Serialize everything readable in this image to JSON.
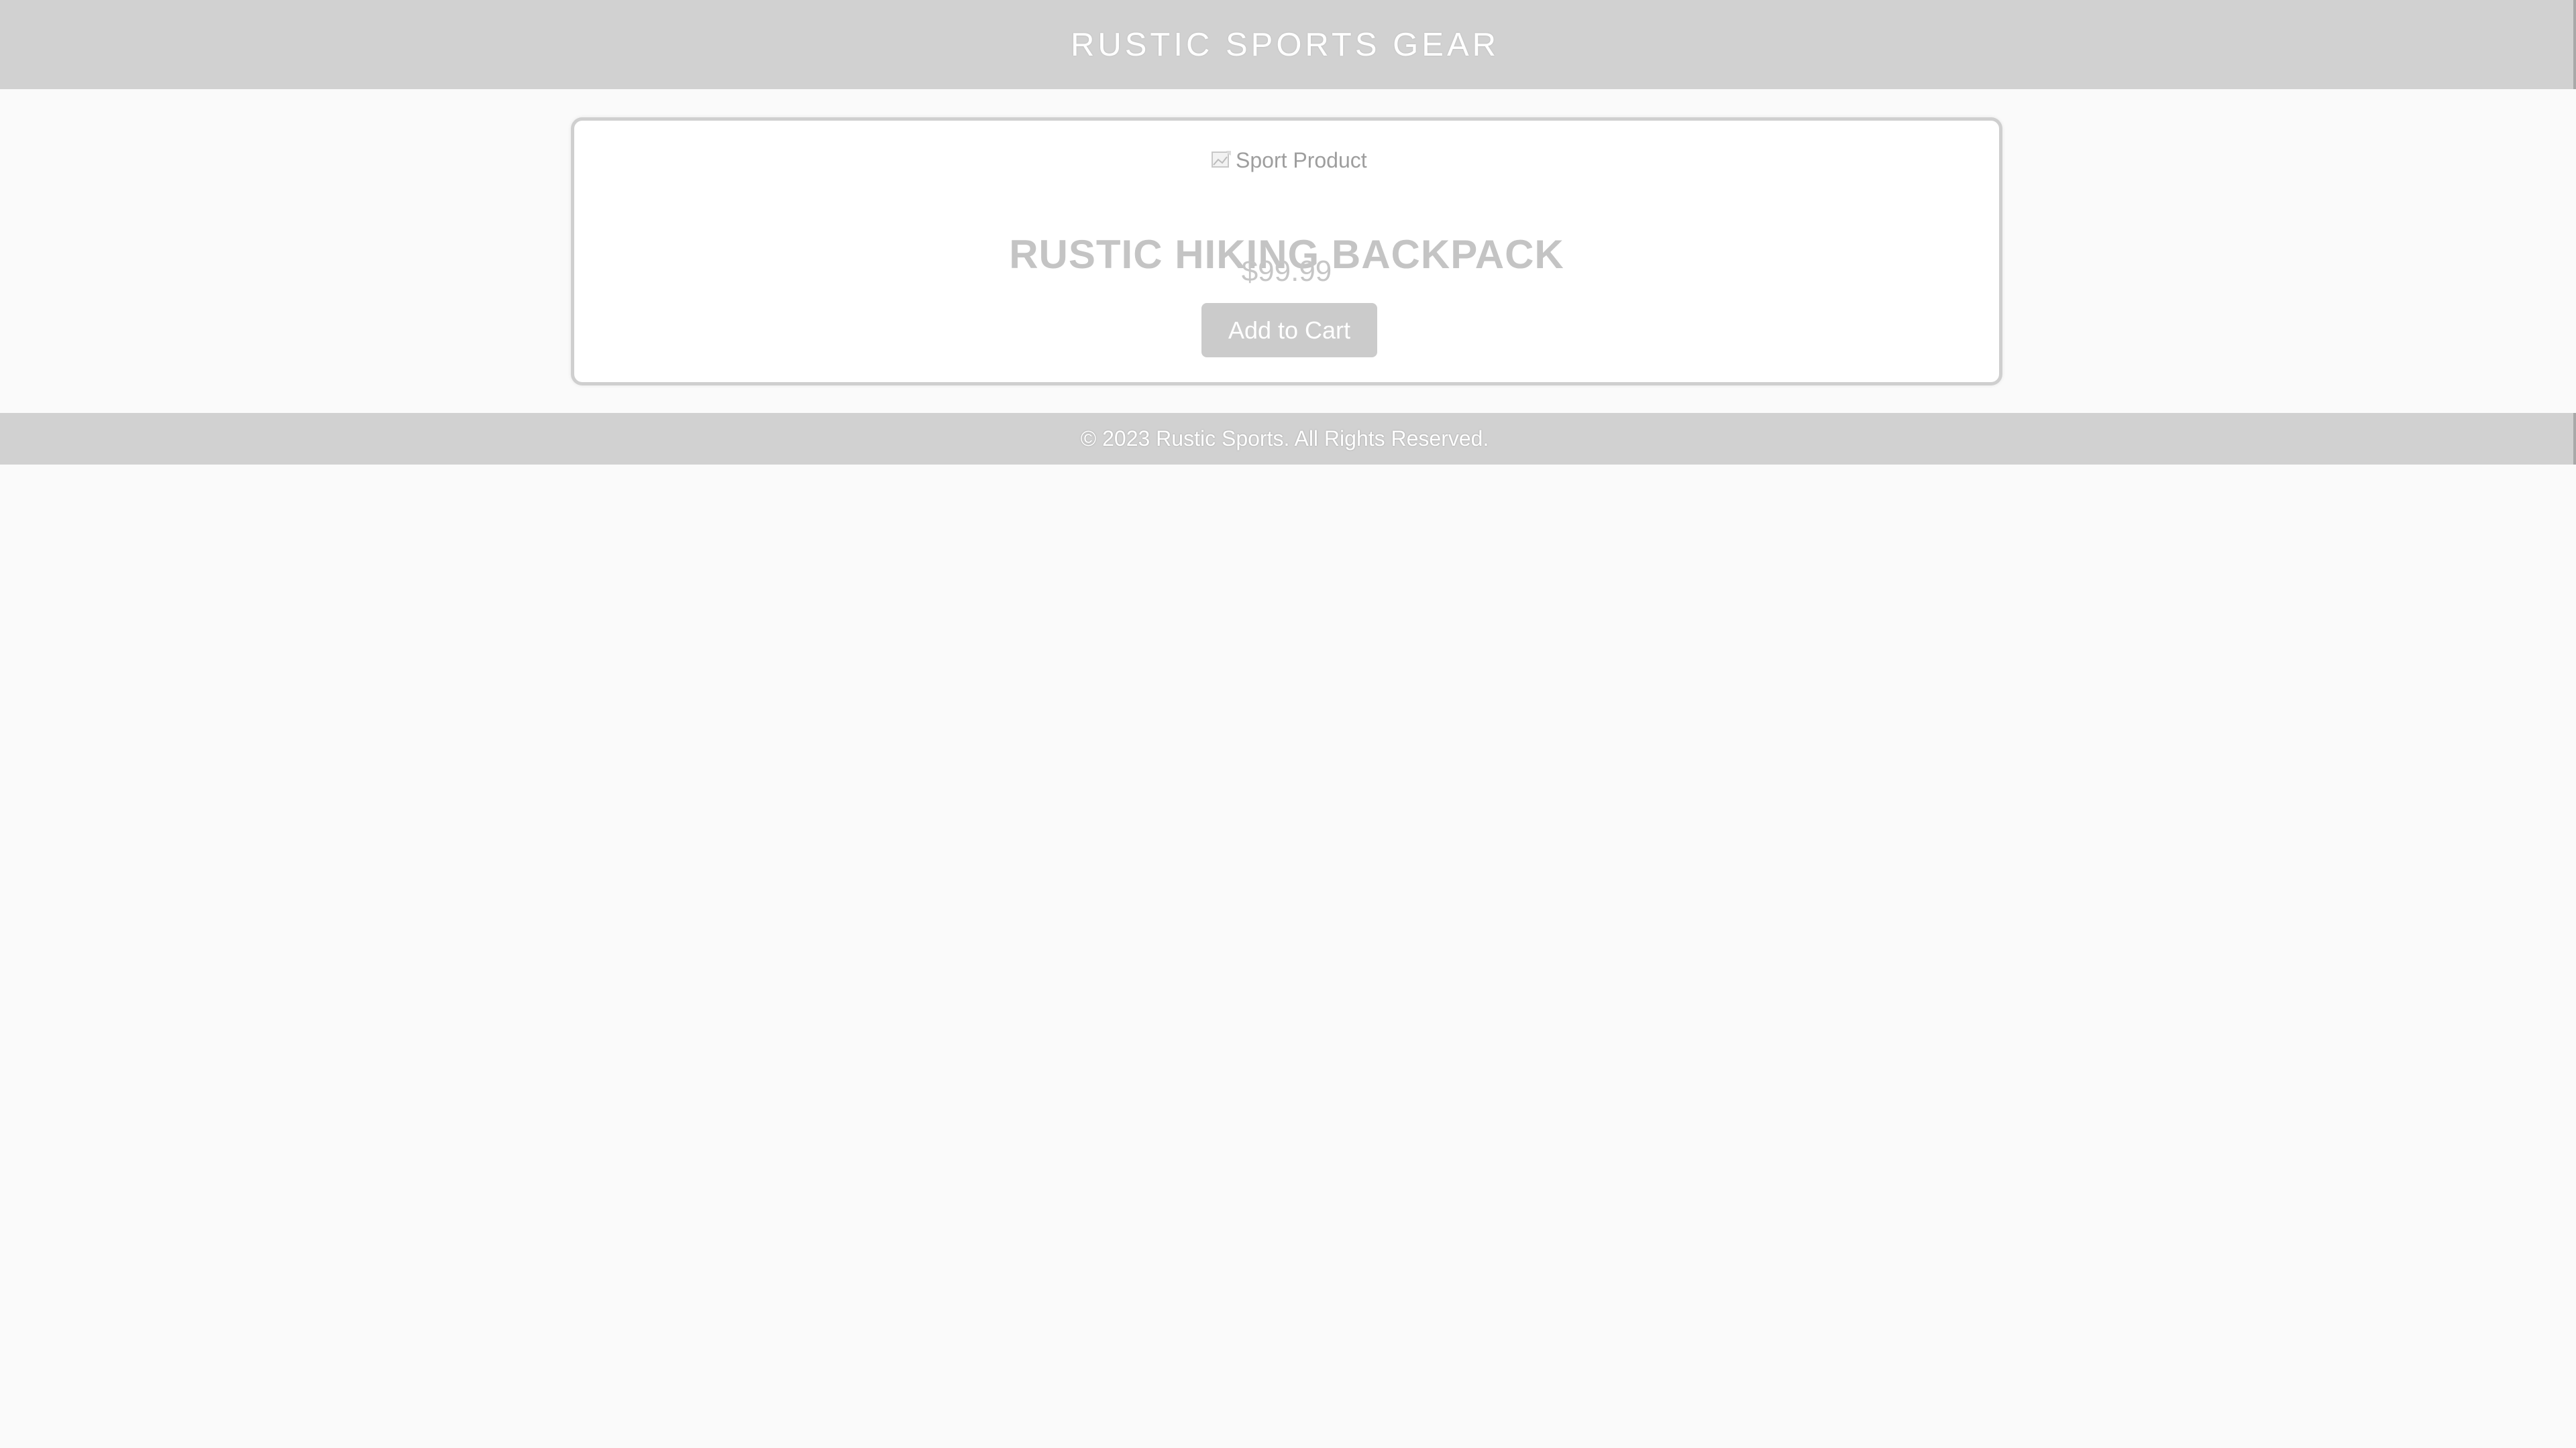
{
  "header": {
    "title": "RUSTIC SPORTS GEAR"
  },
  "product": {
    "image_alt": "Sport Product",
    "image_icon": "broken-image-icon",
    "title": "RUSTIC HIKING BACKPACK",
    "price": "$99.99",
    "add_to_cart_label": "Add to Cart"
  },
  "footer": {
    "text": "© 2023 Rustic Sports. All Rights Reserved."
  },
  "colors": {
    "header_bg": "#d1d1d1",
    "page_bg": "#fafafa",
    "button_bg": "#cbcbcb",
    "text_muted": "#c4c4c4"
  }
}
